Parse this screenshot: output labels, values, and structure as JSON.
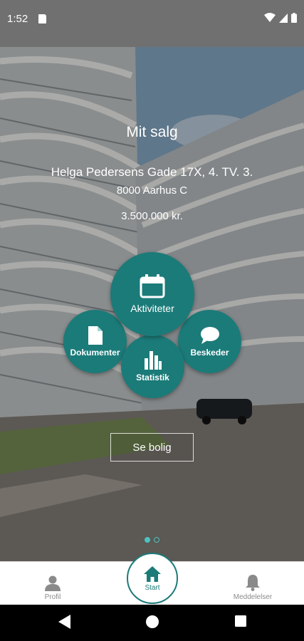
{
  "status_bar": {
    "time": "1:52"
  },
  "listing": {
    "title": "Mit salg",
    "address_line1": "Helga Pedersens Gade 17X, 4. TV. 3.",
    "address_line2": "8000 Aarhus C",
    "price": "3.500.000 kr."
  },
  "actions": {
    "aktiviteter": "Aktiviteter",
    "dokumenter": "Dokumenter",
    "beskeder": "Beskeder",
    "statistik": "Statistik"
  },
  "se_bolig_label": "Se bolig",
  "pager": {
    "pages": 2,
    "current": 1
  },
  "tabs": {
    "profil": "Profil",
    "start": "Start",
    "meddelelser": "Meddelelser"
  },
  "colors": {
    "accent": "#1b7b79",
    "pager": "#4cc3bf"
  }
}
